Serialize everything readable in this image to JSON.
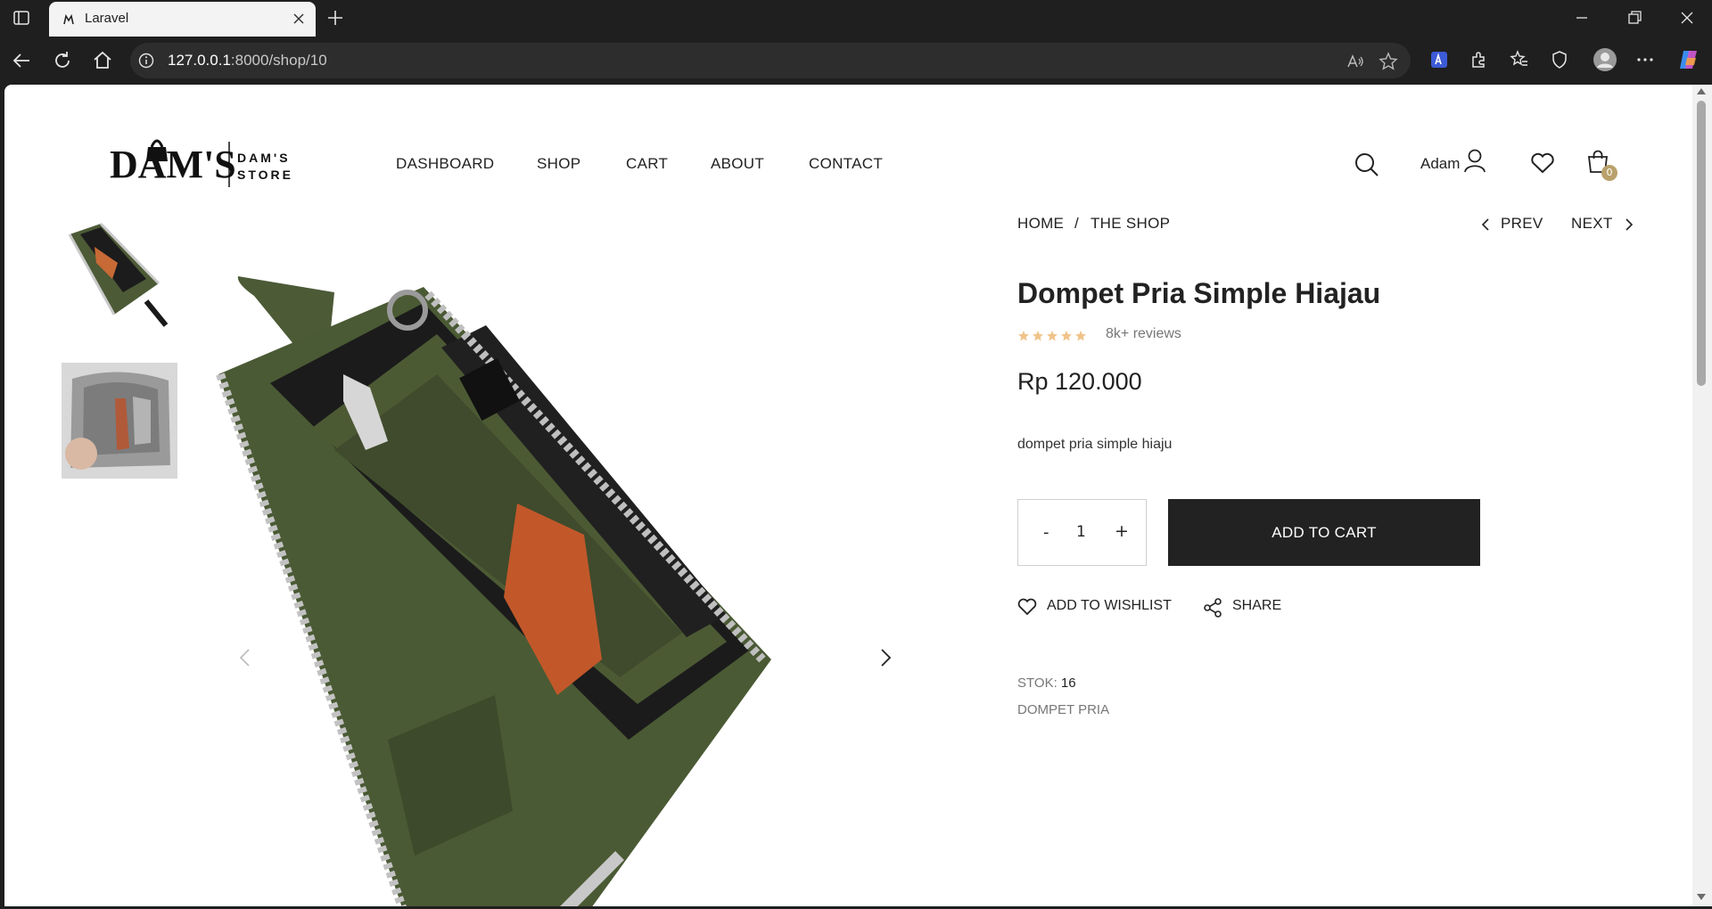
{
  "browser": {
    "tab_title": "Laravel",
    "url_host": "127.0.0.1",
    "url_path": ":8000/shop/10"
  },
  "header": {
    "logo": {
      "brand": "DAM'S",
      "store": "DAM'S STORE"
    },
    "nav": [
      "DASHBOARD",
      "SHOP",
      "CART",
      "ABOUT",
      "CONTACT"
    ],
    "user_name": "Adam",
    "cart_count": "0"
  },
  "breadcrumb": {
    "home": "HOME",
    "separator": "/",
    "shop": "THE SHOP",
    "prev": "PREV",
    "next": "NEXT"
  },
  "product": {
    "title": "Dompet Pria Simple Hiajau",
    "rating": 5,
    "reviews": "8k+ reviews",
    "price": "Rp 120.000",
    "description": "dompet pria simple hiaju",
    "quantity": "1",
    "qty_minus": "-",
    "qty_plus": "+",
    "add_to_cart": "ADD TO CART",
    "wishlist": "ADD TO WISHLIST",
    "share": "SHARE",
    "stock_label": "STOK:",
    "stock_value": "16",
    "category": "DOMPET PRIA"
  },
  "colors": {
    "text": "#222222",
    "muted": "#777777",
    "button": "#222222",
    "star": "#f0c38a",
    "badge": "#b9a16b",
    "wallet": "#4c5a36"
  }
}
